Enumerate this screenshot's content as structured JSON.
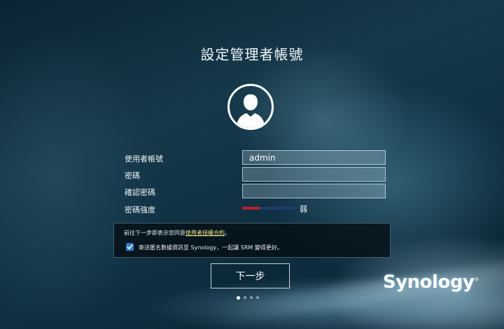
{
  "page": {
    "title": "設定管理者帳號"
  },
  "form": {
    "username_label": "使用者帳號",
    "username_value": "admin",
    "password_label": "密碼",
    "password_value": "",
    "confirm_label": "確認密碼",
    "confirm_value": "",
    "strength_label": "密碼強度",
    "strength_value": "弱",
    "strength_level": 0.33,
    "strength_colors": [
      "#b8202a",
      "#1c3e6e",
      "#1c3e6e"
    ]
  },
  "notice": {
    "agree_prefix": "前往下一步即表示您同意",
    "agree_link": "使用者授權合約",
    "agree_suffix": "。",
    "checkbox_label": "寄送匿名數據資訊至 Synology，一起讓 SRM 變得更好。",
    "checkbox_checked": true
  },
  "actions": {
    "next_label": "下一步"
  },
  "pagination": {
    "total": 4,
    "current": 1
  },
  "brand": {
    "logo_text": "Synology",
    "trademark": "®"
  },
  "icons": {
    "avatar": "user-silhouette-icon",
    "check": "checkmark-icon"
  }
}
